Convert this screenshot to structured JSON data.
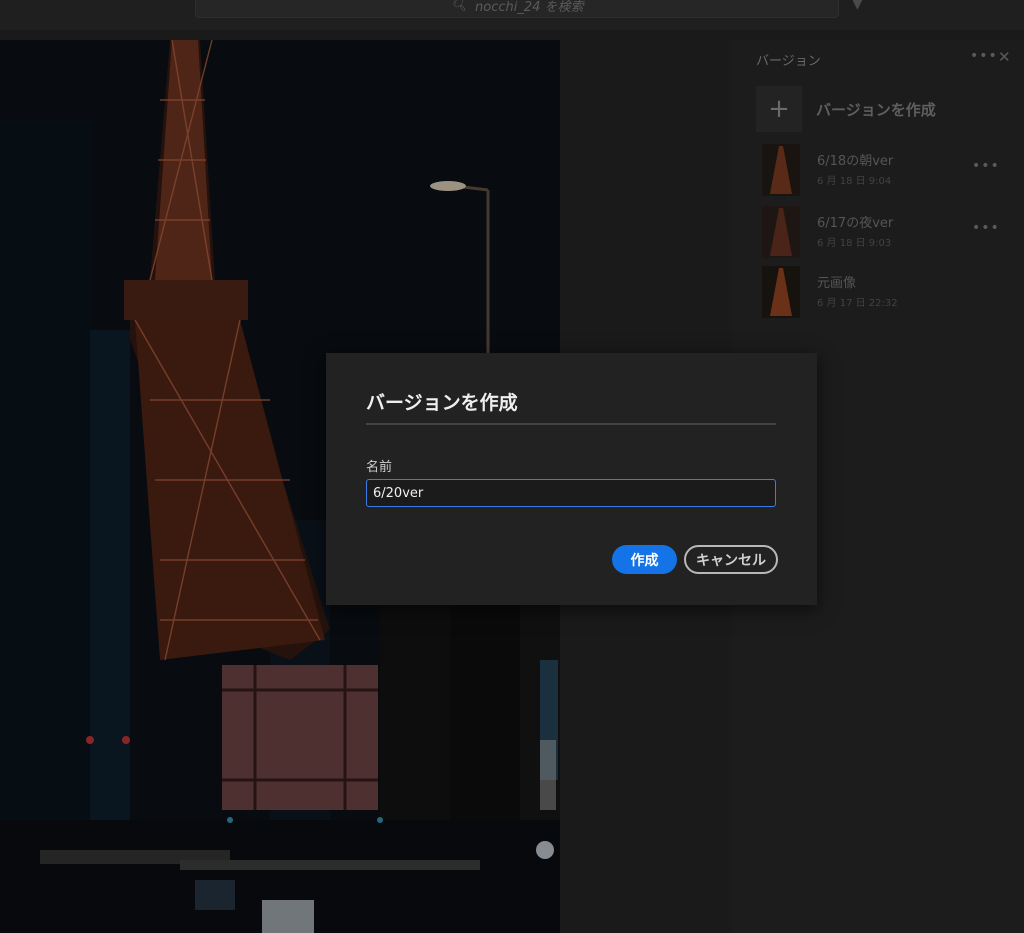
{
  "search": {
    "placeholder": "nocchi_24 を検索"
  },
  "panel": {
    "title": "バージョン",
    "create_label": "バージョンを作成",
    "versions": [
      {
        "name": "6/18の朝ver",
        "date": "6 月 18 日 9:04"
      },
      {
        "name": "6/17の夜ver",
        "date": "6 月 18 日 9:03"
      },
      {
        "name": "元画像",
        "date": "6 月 17 日 22:32"
      }
    ]
  },
  "dialog": {
    "title": "バージョンを作成",
    "name_label": "名前",
    "name_value": "6/20ver",
    "create_button": "作成",
    "cancel_button": "キャンセル"
  },
  "colors": {
    "accent": "#1473e6",
    "input_focus": "#3b7de8",
    "dialog_bg": "#222222"
  }
}
